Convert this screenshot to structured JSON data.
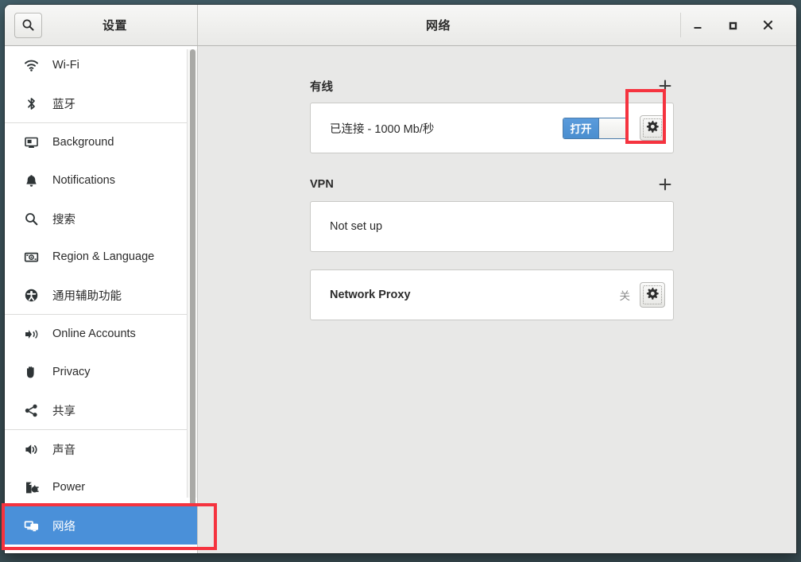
{
  "window": {
    "sidebar_title": "设置",
    "main_title": "网络",
    "search_icon": "search-icon",
    "controls": {
      "minimize": "minimize-icon",
      "maximize": "maximize-icon",
      "close": "close-icon"
    }
  },
  "sidebar": {
    "groups": [
      {
        "items": [
          {
            "label": "Wi-Fi",
            "icon": "wifi-icon",
            "selected": false
          },
          {
            "label": "蓝牙",
            "icon": "bluetooth-icon",
            "selected": false
          }
        ]
      },
      {
        "items": [
          {
            "label": "Background",
            "icon": "background-icon",
            "selected": false
          },
          {
            "label": "Notifications",
            "icon": "bell-icon",
            "selected": false
          },
          {
            "label": "搜索",
            "icon": "search-icon",
            "selected": false
          },
          {
            "label": "Region & Language",
            "icon": "region-language-icon",
            "selected": false
          },
          {
            "label": "通用辅助功能",
            "icon": "accessibility-icon",
            "selected": false
          }
        ]
      },
      {
        "items": [
          {
            "label": "Online Accounts",
            "icon": "online-accounts-icon",
            "selected": false
          },
          {
            "label": "Privacy",
            "icon": "hand-icon",
            "selected": false
          },
          {
            "label": "共享",
            "icon": "share-icon",
            "selected": false
          }
        ]
      },
      {
        "items": [
          {
            "label": "声音",
            "icon": "speaker-icon",
            "selected": false
          },
          {
            "label": "Power",
            "icon": "power-plug-icon",
            "selected": false
          },
          {
            "label": "网络",
            "icon": "network-icon",
            "selected": true
          }
        ]
      }
    ]
  },
  "main": {
    "wired": {
      "section_title": "有线",
      "add_label": "+",
      "status": "已连接 - 1000 Mb/秒",
      "toggle_label": "打开",
      "toggle_state": "on",
      "settings_icon": "gear-icon"
    },
    "vpn": {
      "section_title": "VPN",
      "add_label": "+",
      "status": "Not set up"
    },
    "proxy": {
      "label": "Network Proxy",
      "status": "关",
      "settings_icon": "gear-icon"
    }
  },
  "colors": {
    "selection": "#4a90d9",
    "annotation": "#f5333f",
    "panel_bg": "#e8e8e7",
    "toggle_on": "#4a8ecf"
  }
}
